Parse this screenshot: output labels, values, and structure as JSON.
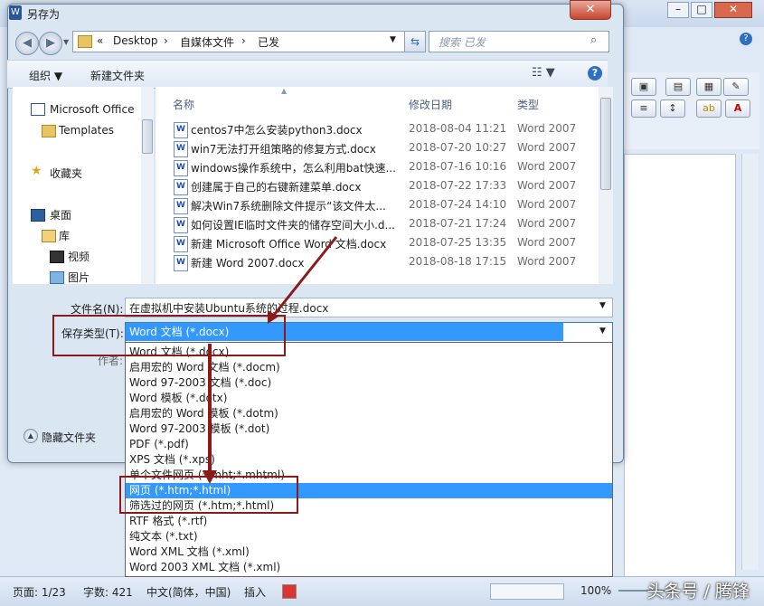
{
  "dialog": {
    "title": "另存为",
    "app_icon": "word-icon",
    "close_label": "✕"
  },
  "address": {
    "prefix": "«",
    "crumbs": [
      "Desktop",
      "自媒体文件",
      "已发"
    ],
    "search_placeholder": "搜索 已发"
  },
  "toolbar": {
    "organize_label": "组织 ▼",
    "new_folder_label": "新建文件夹",
    "view_icon": "view-list-icon",
    "help_label": "?"
  },
  "nav": {
    "items": [
      {
        "label": "Microsoft Office",
        "icon": "word-doc-icon"
      },
      {
        "label": "Templates",
        "icon": "folder-icon"
      },
      {
        "label": "收藏夹",
        "icon": "star-icon"
      },
      {
        "label": "桌面",
        "icon": "desktop-icon"
      },
      {
        "label": "库",
        "icon": "library-icon"
      },
      {
        "label": "视频",
        "icon": "video-icon"
      },
      {
        "label": "图片",
        "icon": "picture-icon"
      }
    ]
  },
  "files": {
    "columns": [
      "名称",
      "修改日期",
      "类型"
    ],
    "rows": [
      {
        "name": "centos7中怎么安装python3.docx",
        "date": "2018-08-04 11:21",
        "type": "Word 2007"
      },
      {
        "name": "win7无法打开组策略的修复方式.docx",
        "date": "2018-07-20 10:27",
        "type": "Word 2007"
      },
      {
        "name": "windows操作系统中，怎么利用bat快速...",
        "date": "2018-07-16 10:16",
        "type": "Word 2007"
      },
      {
        "name": "创建属于自己的右键新建菜单.docx",
        "date": "2018-07-22 17:33",
        "type": "Word 2007"
      },
      {
        "name": "解决Win7系统删除文件提示“该文件太...",
        "date": "2018-07-24 14:10",
        "type": "Word 2007"
      },
      {
        "name": "如何设置IE临时文件夹的储存空间大小.d...",
        "date": "2018-07-21 17:24",
        "type": "Word 2007"
      },
      {
        "name": "新建 Microsoft Office Word 文档.docx",
        "date": "2018-07-25 13:35",
        "type": "Word 2007"
      },
      {
        "name": "新建 Word 2007.docx",
        "date": "2018-08-18 17:15",
        "type": "Word 2007"
      }
    ]
  },
  "form": {
    "filename_label": "文件名(N):",
    "filename_value": "在虚拟机中安装Ubuntu系统的过程.docx",
    "filetype_label": "保存类型(T):",
    "filetype_value": "Word 文档 (*.docx)",
    "author_label": "作者:",
    "hide_folders_label": "隐藏文件夹"
  },
  "dropdown": {
    "options": [
      "Word 文档 (*.docx)",
      "启用宏的 Word 文档 (*.docm)",
      "Word 97-2003 文档 (*.doc)",
      "Word 模板 (*.dotx)",
      "启用宏的 Word 模板 (*.dotm)",
      "Word 97-2003 模板 (*.dot)",
      "PDF (*.pdf)",
      "XPS 文档 (*.xps)",
      "单个文件网页 (*.mht;*.mhtml)",
      "网页 (*.htm;*.html)",
      "筛选过的网页 (*.htm;*.html)",
      "RTF 格式 (*.rtf)",
      "纯文本 (*.txt)",
      "Word XML 文档 (*.xml)",
      "Word 2003 XML 文档 (*.xml)"
    ],
    "selected_index": 9
  },
  "statusbar": {
    "page": "页面: 1/23",
    "words": "字数: 421",
    "language": "中文(简体，中国)",
    "insert": "插入",
    "zoom": "100%"
  },
  "watermark": "头条号 / 腾锋",
  "colors": {
    "selection": "#3399ff",
    "annotation": "#8b1a1a",
    "dialog_bg": "#dbe6f3"
  }
}
